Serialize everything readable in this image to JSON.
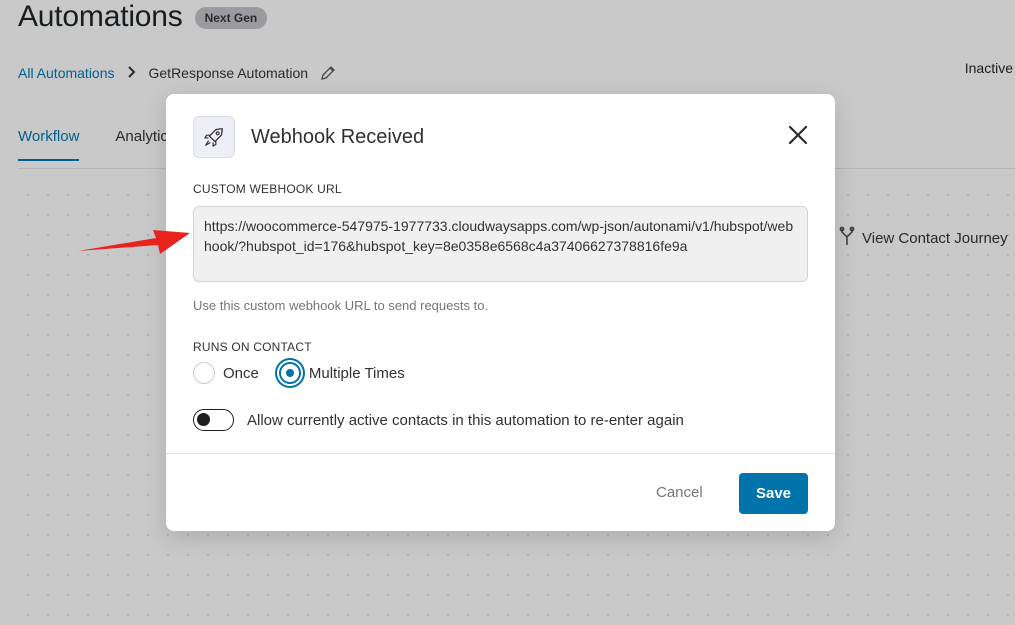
{
  "page": {
    "title": "Automations",
    "badge": "Next Gen",
    "breadcrumb_root": "All Automations",
    "breadcrumb_current": "GetResponse Automation",
    "status": "Inactive",
    "tabs": [
      {
        "label": "Workflow"
      },
      {
        "label": "Analytic"
      }
    ],
    "view_contact_journey": "View Contact Journey"
  },
  "modal": {
    "title": "Webhook Received",
    "url_label": "CUSTOM WEBHOOK URL",
    "url_value": "https://woocommerce-547975-1977733.cloudwaysapps.com/wp-json/autonami/v1/hubspot/webhook/?hubspot_id=176&hubspot_key=8e0358e6568c4a37406627378816fe9a",
    "help_text": "Use this custom webhook URL to send requests to.",
    "runs_label": "RUNS ON CONTACT",
    "radio_once": "Once",
    "radio_multiple": "Multiple Times",
    "selected_runs": "Multiple Times",
    "toggle_label": "Allow currently active contacts in this automation to re-enter again",
    "toggle_on": false,
    "cancel_label": "Cancel",
    "save_label": "Save"
  },
  "colors": {
    "accent": "#0073aa",
    "annotation_arrow": "#e8231c"
  },
  "icons": [
    "rocket-icon",
    "close-icon",
    "pencil-icon",
    "chevron-right-icon",
    "fork-icon",
    "red-arrow-annotation"
  ]
}
